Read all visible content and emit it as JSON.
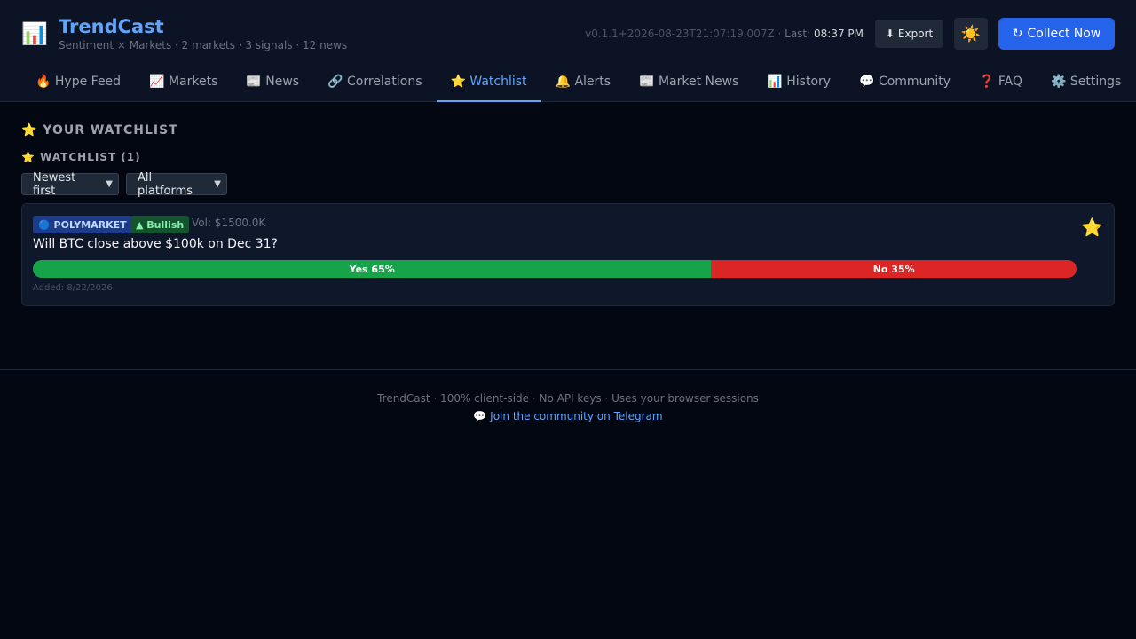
{
  "header": {
    "brand_icon": "chart-icon",
    "title": "TrendCast",
    "subtitle": "Sentiment × Markets · 2 markets · 3 signals · 12 news",
    "version": "v0.1.1+2026-08-23T21:07:19.007Z · ",
    "last_label": "Last: ",
    "last_time": "08:37 PM",
    "export_icon": "⬇",
    "export_label": "Export",
    "theme_icon": "☀️",
    "collect_icon": "↻",
    "collect_label": "Collect Now"
  },
  "tabs": [
    {
      "icon": "🔥",
      "label": "Hype Feed"
    },
    {
      "icon": "📈",
      "label": "Markets"
    },
    {
      "icon": "📰",
      "label": "News"
    },
    {
      "icon": "🔗",
      "label": "Correlations"
    },
    {
      "icon": "⭐",
      "label": "Watchlist",
      "active": true
    },
    {
      "icon": "🔔",
      "label": "Alerts"
    },
    {
      "icon": "📰",
      "label": "Market News"
    },
    {
      "icon": "📊",
      "label": "History"
    },
    {
      "icon": "💬",
      "label": "Community"
    },
    {
      "icon": "❓",
      "label": "FAQ"
    },
    {
      "icon": "⚙️",
      "label": "Settings"
    }
  ],
  "main": {
    "section_title": "⭐ YOUR WATCHLIST",
    "sub_title": "⭐ WATCHLIST (1)",
    "sort_select": "Newest first",
    "platform_select": "All platforms"
  },
  "watchlist": [
    {
      "platform": "🔵 POLYMARKET",
      "sentiment": "▲ Bullish",
      "volume": "Vol: $1500.0K",
      "question": "Will BTC close above $100k on Dec 31?",
      "yes_label": "Yes 65%",
      "no_label": "No 35%",
      "yes_fraction": 0.65,
      "added": "Added: 8/22/2026",
      "star": "⭐"
    }
  ],
  "footer": {
    "text": "TrendCast · 100% client-side · No API keys · Uses your browser sessions",
    "link": "💬 Join the community on Telegram"
  },
  "colors": {
    "accent": "#60a5fa",
    "primary_button": "#2563eb",
    "yes": "#16a34a",
    "no": "#dc2626"
  }
}
